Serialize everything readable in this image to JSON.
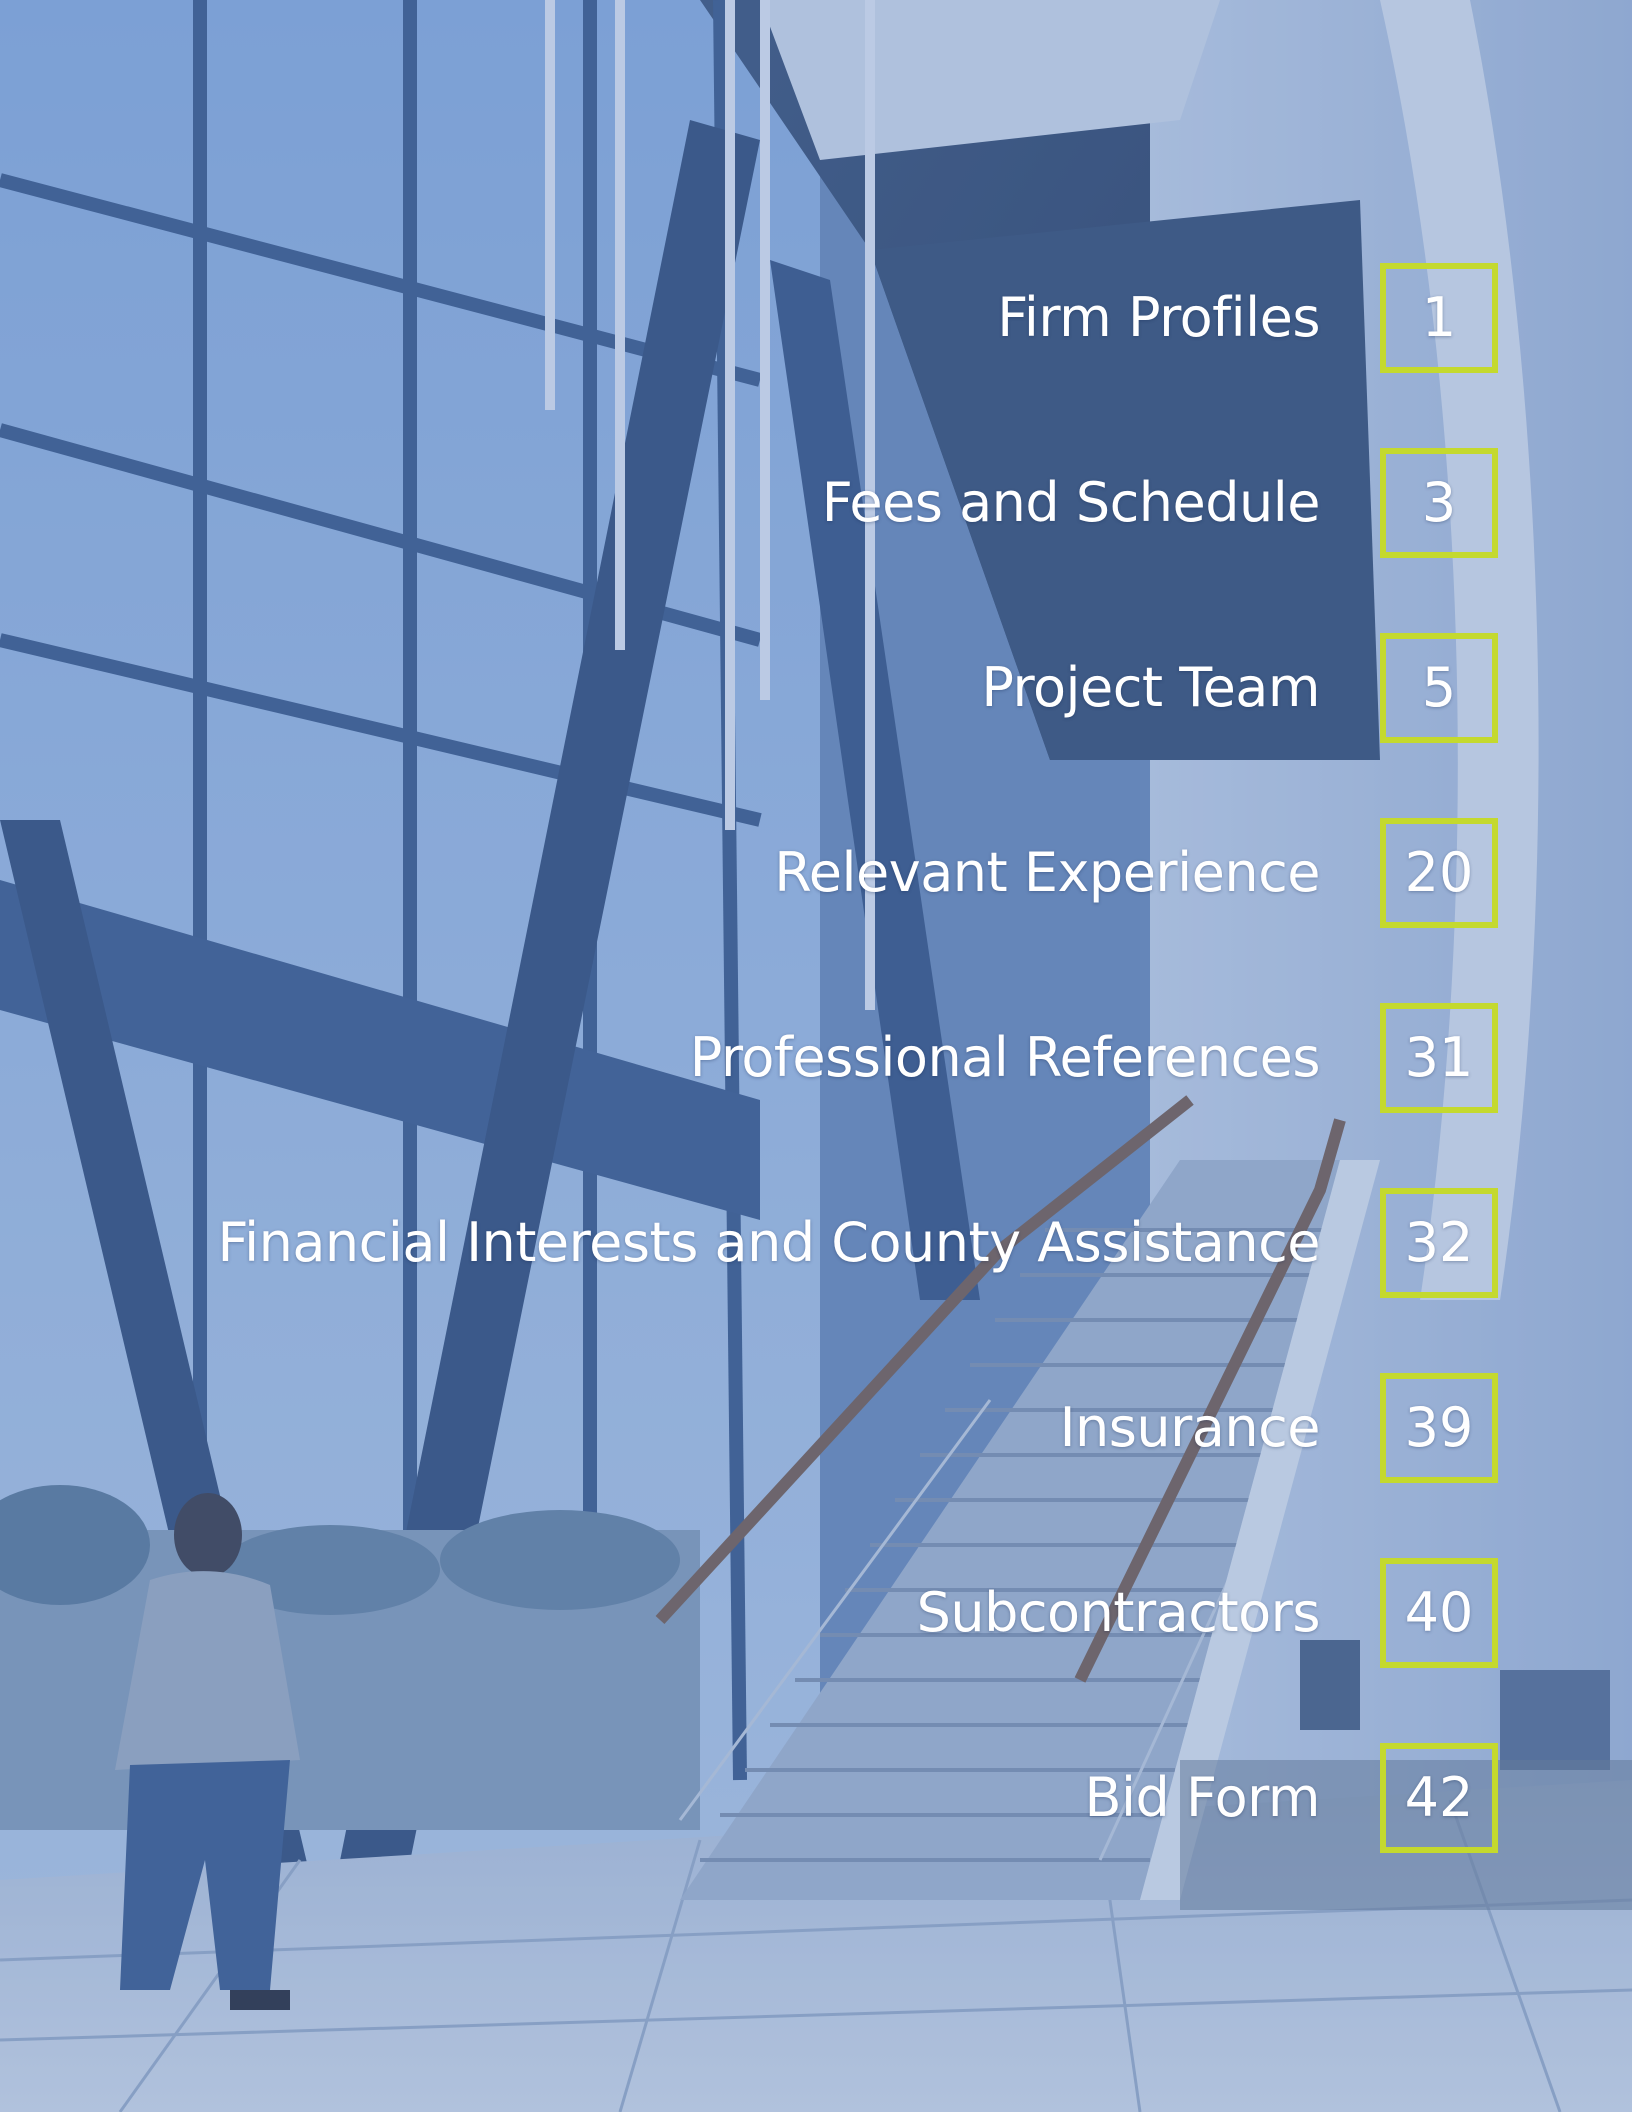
{
  "colors": {
    "accent_box_border": "#c4d92e",
    "text": "#ffffff",
    "overlay_tint": "#4a6eaa"
  },
  "background": {
    "description_icon": "atrium-photo"
  },
  "toc": [
    {
      "label": "Firm Profiles",
      "page": "1"
    },
    {
      "label": "Fees and Schedule",
      "page": "3"
    },
    {
      "label": "Project Team",
      "page": "5"
    },
    {
      "label": "Relevant Experience",
      "page": "20"
    },
    {
      "label": "Professional References",
      "page": "31"
    },
    {
      "label": "Financial Interests and County Assistance",
      "page": "32"
    },
    {
      "label": "Insurance",
      "page": "39"
    },
    {
      "label": "Subcontractors",
      "page": "40"
    },
    {
      "label": "Bid Form",
      "page": "42"
    }
  ]
}
